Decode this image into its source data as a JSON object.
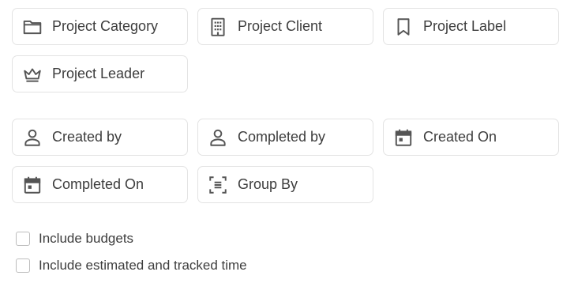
{
  "filter_buttons": [
    {
      "label": "Project Category",
      "icon": "folder-icon"
    },
    {
      "label": "Project Client",
      "icon": "building-icon"
    },
    {
      "label": "Project Label",
      "icon": "bookmark-icon"
    },
    {
      "label": "Project Leader",
      "icon": "crown-icon"
    },
    {
      "label": "Created by",
      "icon": "person-icon"
    },
    {
      "label": "Completed by",
      "icon": "person-icon"
    },
    {
      "label": "Created On",
      "icon": "calendar-icon"
    },
    {
      "label": "Completed On",
      "icon": "calendar-icon"
    },
    {
      "label": "Group By",
      "icon": "group-by-icon"
    }
  ],
  "options": [
    {
      "label": "Include budgets",
      "checked": false
    },
    {
      "label": "Include estimated and tracked time",
      "checked": false
    }
  ],
  "colors": {
    "icon": "#555555",
    "border": "#e3e3e3",
    "text": "#3d3d3d"
  }
}
